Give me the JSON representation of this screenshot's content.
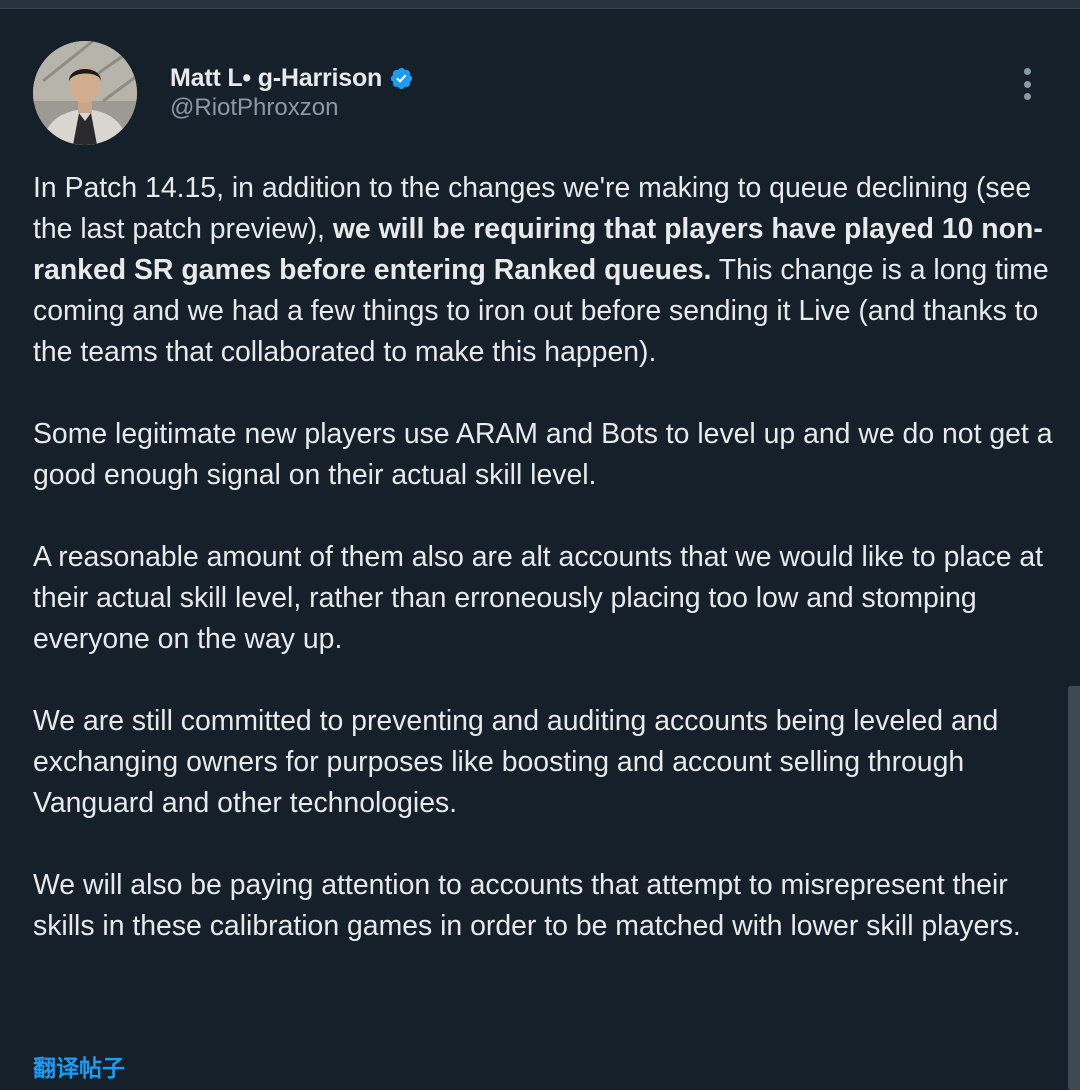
{
  "author": {
    "display_name": "Matt L• g-Harrison",
    "handle": "@RiotPhroxzon",
    "verified": true
  },
  "icons": {
    "avatar": "profile-photo",
    "verified": "verified-badge-icon",
    "more": "more-options-icon"
  },
  "tweet": {
    "p1_intro": "In Patch 14.15, in addition to the changes we're making to queue declining (see the last patch preview), ",
    "p1_bold": "we will be requiring that players have played 10 non-ranked SR games before entering Ranked queues.",
    "p1_rest": " This change is a long time coming and we had a few things to iron out before sending it Live (and thanks to the teams that collaborated to make this happen).",
    "p2": "Some legitimate new players use ARAM and Bots to level up and we do not get a good enough signal on their actual skill level.",
    "p3": "A reasonable amount of them also are alt accounts that we would like to place at their actual skill level, rather than erroneously placing too low and stomping everyone on the way up.",
    "p4": "We are still committed to preventing and auditing accounts being leveled and exchanging owners for purposes like boosting and account selling through Vanguard and other technologies.",
    "p5": "We will also be paying attention to accounts that attempt to misrepresent their skills in these calibration games in order to be matched with lower skill players."
  },
  "translate_label": "翻译帖子",
  "colors": {
    "background": "#15202b",
    "text_primary": "#e7e9ea",
    "text_secondary": "#8b98a5",
    "accent": "#1d9bf0"
  }
}
